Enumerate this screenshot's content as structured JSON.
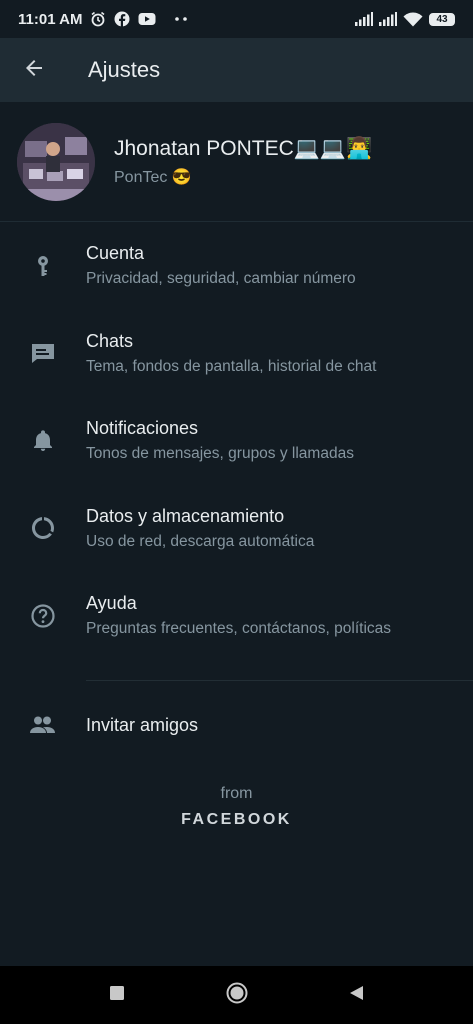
{
  "status_bar": {
    "time": "11:01 AM",
    "battery": "43",
    "icons": [
      "alarm-icon",
      "facebook-icon",
      "youtube-icon",
      "more-dots-icon",
      "signal-icon",
      "signal-icon",
      "wifi-icon",
      "battery-icon"
    ]
  },
  "header": {
    "title": "Ajustes",
    "back_icon": "arrow-back-icon"
  },
  "profile": {
    "name": "Jhonatan PONTEC💻💻👨‍💻",
    "status": "PonTec 😎"
  },
  "menu": {
    "items": [
      {
        "title": "Cuenta",
        "subtitle": "Privacidad, seguridad, cambiar número",
        "icon": "key-icon"
      },
      {
        "title": "Chats",
        "subtitle": "Tema, fondos de pantalla, historial de chat",
        "icon": "chat-icon"
      },
      {
        "title": "Notificaciones",
        "subtitle": "Tonos de mensajes, grupos y llamadas",
        "icon": "bell-icon"
      },
      {
        "title": "Datos y almacenamiento",
        "subtitle": "Uso de red, descarga automática",
        "icon": "data-usage-icon"
      },
      {
        "title": "Ayuda",
        "subtitle": "Preguntas frecuentes, contáctanos, políticas",
        "icon": "help-icon"
      }
    ],
    "invite": {
      "title": "Invitar amigos",
      "icon": "people-icon"
    }
  },
  "footer": {
    "from": "from",
    "brand": "FACEBOOK"
  },
  "nav_bar": {
    "icons": [
      "recents-icon",
      "home-icon",
      "back-icon"
    ]
  },
  "colors": {
    "background": "#121b22",
    "app_bar": "#1f2c34",
    "primary_text": "#e9edef",
    "secondary_text": "#8696a0",
    "icon": "#8696a0"
  }
}
